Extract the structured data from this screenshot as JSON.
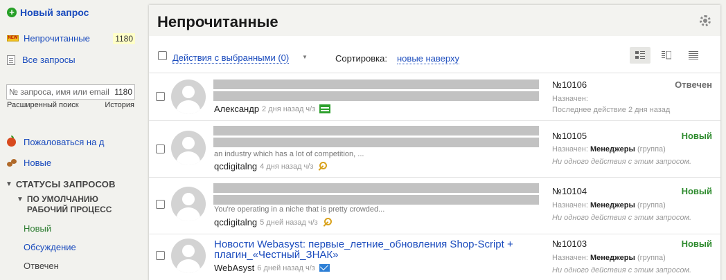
{
  "sidebar": {
    "new_request": "Новый запрос",
    "unread": "Непрочитанные",
    "unread_count": "1180",
    "all_requests": "Все запросы",
    "search_placeholder": "№ запроса, имя или email",
    "search_count": "1180",
    "advanced_search": "Расширенный поиск",
    "history": "История",
    "complain": "Пожаловаться на д",
    "news": "Новые",
    "statuses_title": "СТАТУСЫ ЗАПРОСОВ",
    "workflow_title_line1": "ПО УМОЛЧАНИЮ",
    "workflow_title_line2": "РАБОЧИЙ ПРОЦЕСС",
    "statuses": [
      "Новый",
      "Обсуждение",
      "Отвечен"
    ]
  },
  "main": {
    "title": "Непрочитанные",
    "actions_label": "Действия с выбранными (0)",
    "sort_label": "Сортировка:",
    "sort_value": "новые наверху"
  },
  "requests": [
    {
      "subject": "",
      "preview": "",
      "author": "Александр",
      "ago": "2 дня назад ч/з",
      "source_icon": "shop-icon",
      "number": "№10106",
      "status": "Отвечен",
      "assigned_label": "Назначен:",
      "assigned_value": "",
      "assigned_suffix": "",
      "meta": "Последнее действие 2 дня назад"
    },
    {
      "subject": "",
      "preview": "an industry which has a lot of competition, ...",
      "author": "qcdigitalng",
      "ago": "4 дня назад ч/з",
      "source_icon": "key-icon",
      "number": "№10105",
      "status": "Новый",
      "assigned_label": "Назначен:",
      "assigned_value": "Менеджеры",
      "assigned_suffix": "(группа)",
      "meta": "Ни одного действия с этим запросом."
    },
    {
      "subject": "",
      "preview": "You're operating in a niche that is pretty crowded...",
      "author": "qcdigitalng",
      "ago": "5 дней назад ч/з",
      "source_icon": "key-icon",
      "number": "№10104",
      "status": "Новый",
      "assigned_label": "Назначен:",
      "assigned_value": "Менеджеры",
      "assigned_suffix": "(группа)",
      "meta": "Ни одного действия с этим запросом."
    },
    {
      "subject": "Новости Webasyst: первые_летние_обновления Shop-Script + плагин_«Честный_ЗНАК»",
      "preview": "",
      "author": "WebAsyst",
      "ago": "6 дней назад ч/з",
      "source_icon": "mail-icon",
      "number": "№10103",
      "status": "Новый",
      "assigned_label": "Назначен:",
      "assigned_value": "Менеджеры",
      "assigned_suffix": "(группа)",
      "meta": "Ни одного действия с этим запросом."
    }
  ]
}
